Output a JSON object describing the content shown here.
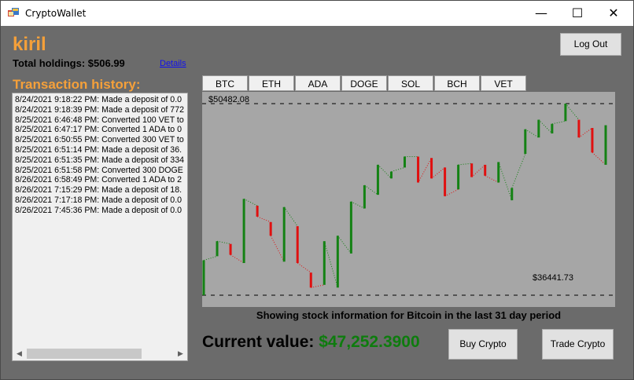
{
  "window": {
    "title": "CryptoWallet",
    "minimize_glyph": "—",
    "maximize_glyph": "☐",
    "close_glyph": "✕"
  },
  "header": {
    "username": "kiril",
    "total_holdings": "Total holdings: $506.99",
    "details_link": "Details",
    "logout_label": "Log Out"
  },
  "history": {
    "title": "Transaction history:",
    "items": [
      "8/24/2021 9:18:22 PM: Made a deposit of 0.0",
      "8/24/2021 9:18:39 PM: Made a deposit of 772",
      "8/25/2021 6:46:48 PM: Converted 100 VET to",
      "8/25/2021 6:47:17 PM: Converted 1 ADA to 0",
      "8/25/2021 6:50:55 PM: Converted 300 VET to",
      "8/25/2021 6:51:14 PM: Made a deposit of 36.",
      "8/25/2021 6:51:35 PM: Made a deposit of 334",
      "8/25/2021 6:51:58 PM: Converted 300 DOGE",
      "8/26/2021 6:58:49 PM: Converted 1 ADA to 2",
      "8/26/2021 7:15:29 PM: Made a deposit of 18.",
      "8/26/2021 7:17:18 PM: Made a deposit of 0.0",
      "8/26/2021 7:45:36 PM: Made a deposit of 0.0"
    ]
  },
  "tabs": [
    "BTC",
    "ETH",
    "ADA",
    "DOGE",
    "SOL",
    "BCH",
    "VET"
  ],
  "chart": {
    "high_label": "$50482.08",
    "low_label": "$36441.73",
    "caption": "Showing stock information for Bitcoin in the last 31 day period"
  },
  "current": {
    "label": "Current value: ",
    "value": "$47,252.3900"
  },
  "actions": {
    "buy_label": "Buy Crypto",
    "trade_label": "Trade Crypto"
  },
  "colors": {
    "accent": "#f5a03a",
    "up": "#148214",
    "down": "#e01010",
    "value_green": "#0e7c0e"
  },
  "chart_data": {
    "type": "candlestick",
    "ylim": [
      36441.73,
      50482.08
    ],
    "up_color": "#148214",
    "down_color": "#e01010",
    "candles": [
      {
        "open": 36441.7,
        "close": 39000.0
      },
      {
        "open": 39300.0,
        "close": 40400.0
      },
      {
        "open": 40200.0,
        "close": 39400.0
      },
      {
        "open": 38800.0,
        "close": 43500.0
      },
      {
        "open": 43000.0,
        "close": 42200.0
      },
      {
        "open": 41800.0,
        "close": 40800.0
      },
      {
        "open": 38900.0,
        "close": 42900.0
      },
      {
        "open": 41500.0,
        "close": 38800.0
      },
      {
        "open": 38100.0,
        "close": 37000.0
      },
      {
        "open": 37200.0,
        "close": 40400.0
      },
      {
        "open": 37000.0,
        "close": 40800.0
      },
      {
        "open": 39500.0,
        "close": 43300.0
      },
      {
        "open": 42800.0,
        "close": 44500.0
      },
      {
        "open": 43800.0,
        "close": 46000.0
      },
      {
        "open": 45000.0,
        "close": 45500.0
      },
      {
        "open": 45800.0,
        "close": 46600.0
      },
      {
        "open": 46600.0,
        "close": 44700.0
      },
      {
        "open": 46500.0,
        "close": 45000.0
      },
      {
        "open": 45800.0,
        "close": 43700.0
      },
      {
        "open": 44200.0,
        "close": 46000.0
      },
      {
        "open": 46100.0,
        "close": 45100.0
      },
      {
        "open": 46000.0,
        "close": 45200.0
      },
      {
        "open": 44700.0,
        "close": 46200.0
      },
      {
        "open": 43400.0,
        "close": 44300.0
      },
      {
        "open": 46800.0,
        "close": 48600.0
      },
      {
        "open": 48000.0,
        "close": 49300.0
      },
      {
        "open": 48300.0,
        "close": 49000.0
      },
      {
        "open": 49200.0,
        "close": 50482.0
      },
      {
        "open": 49300.0,
        "close": 48000.0
      },
      {
        "open": 48700.0,
        "close": 46900.0
      },
      {
        "open": 46000.0,
        "close": 48900.0
      }
    ]
  }
}
